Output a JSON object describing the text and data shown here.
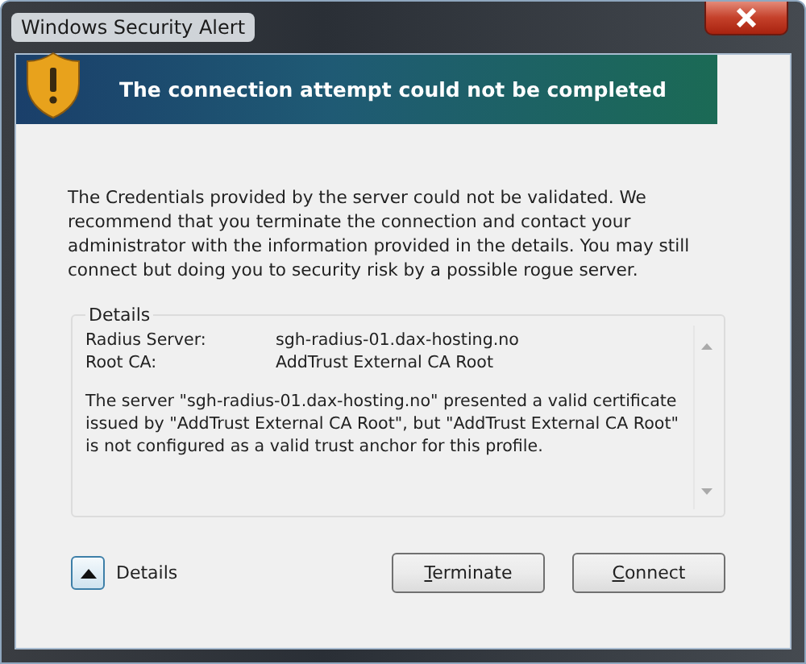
{
  "window": {
    "title": "Windows Security Alert"
  },
  "banner": {
    "heading": "The connection attempt could not be completed"
  },
  "message": "The Credentials provided by the server could not be validated. We recommend that you terminate the connection and contact your administrator with the information provided in the details. You may still connect but doing you to security risk by a possible rogue server.",
  "details": {
    "legend": "Details",
    "fields": [
      {
        "label": "Radius Server:",
        "value": "sgh-radius-01.dax-hosting.no"
      },
      {
        "label": "Root CA:",
        "value": "AddTrust External CA Root"
      }
    ],
    "text": "The server \"sgh-radius-01.dax-hosting.no\" presented a valid certificate issued by \"AddTrust External CA Root\", but \"AddTrust External CA Root\" is not configured as a valid trust anchor for this profile."
  },
  "toggle": {
    "label": "Details",
    "expanded": true
  },
  "buttons": [
    {
      "label": "Terminate",
      "first_letter_underlined": true
    },
    {
      "label": "Connect",
      "first_letter_underlined": true
    }
  ]
}
